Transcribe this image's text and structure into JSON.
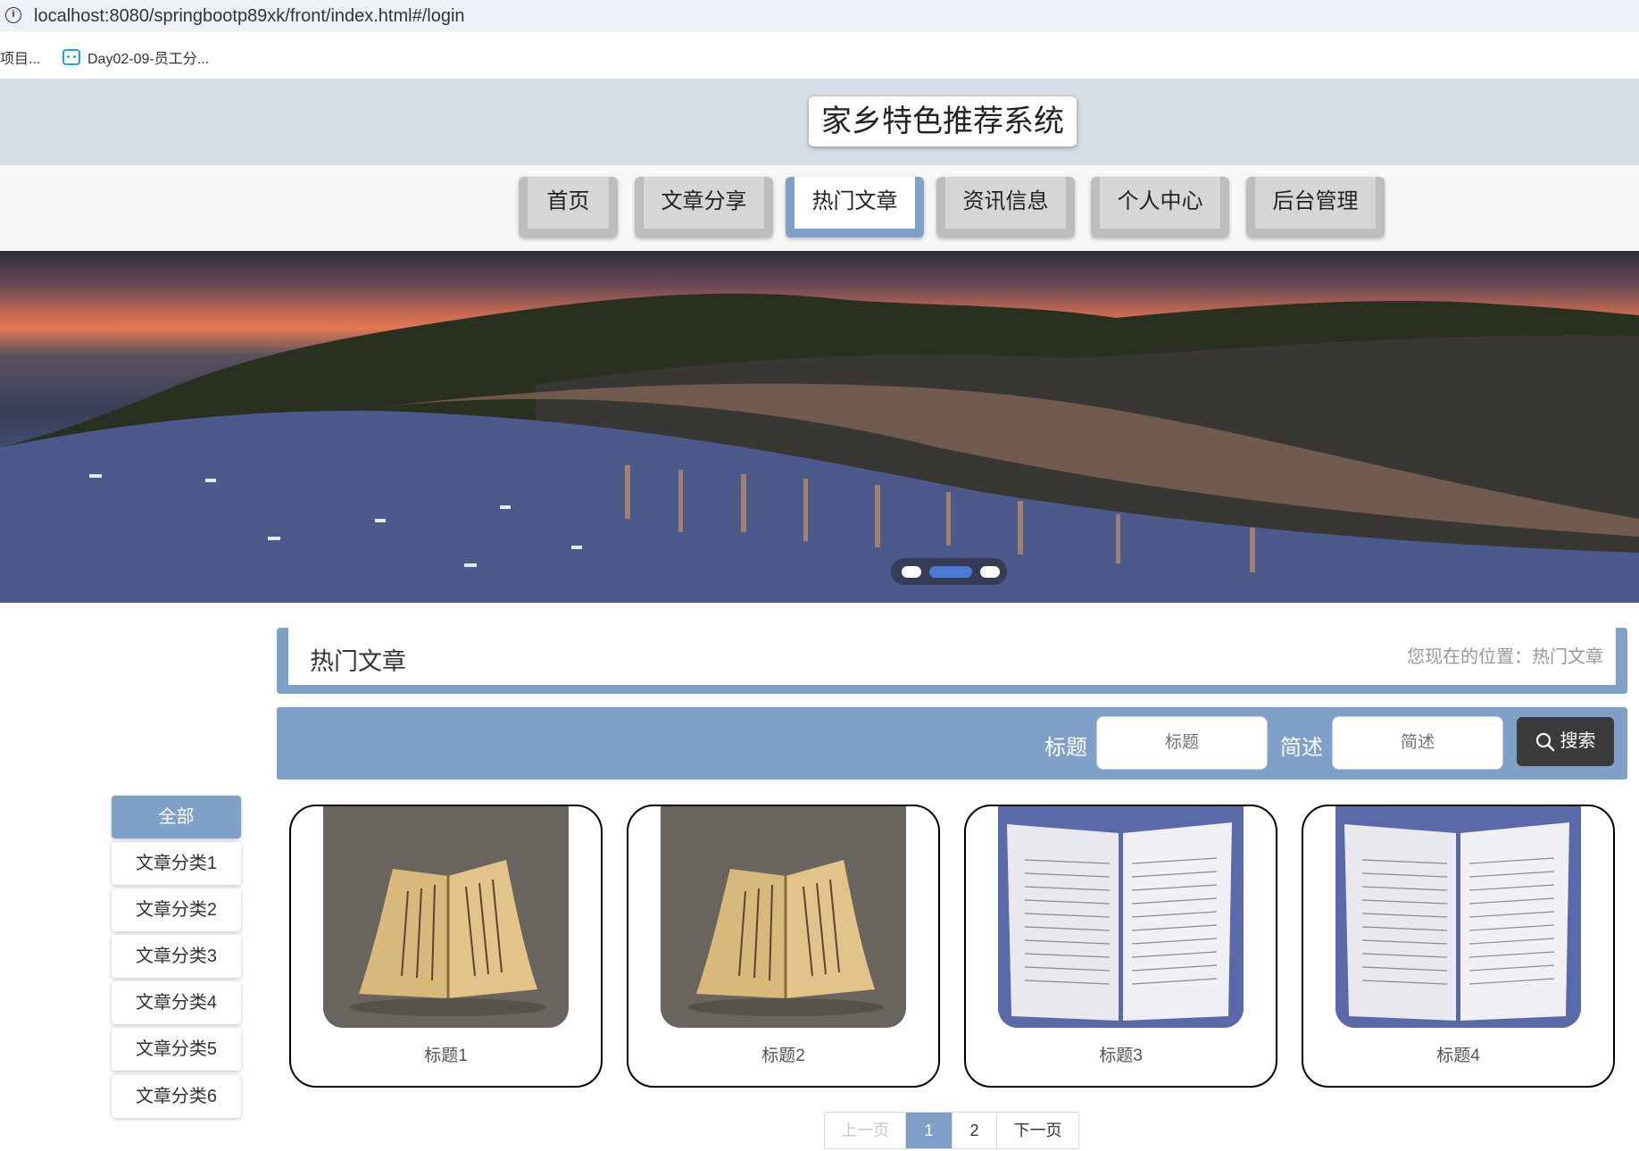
{
  "browser": {
    "url": "localhost:8080/springbootp89xk/front/index.html#/login",
    "bookmarks": [
      "项目...",
      "Day02-09-员工分..."
    ]
  },
  "header": {
    "title": "家乡特色推荐系统"
  },
  "nav": {
    "items": [
      {
        "label": "首页"
      },
      {
        "label": "文章分享"
      },
      {
        "label": "热门文章",
        "active": true
      },
      {
        "label": "资讯信息"
      },
      {
        "label": "个人中心"
      },
      {
        "label": "后台管理"
      }
    ]
  },
  "banner": {
    "slide_count": 3,
    "active_slide": 2
  },
  "section": {
    "title": "热门文章",
    "location": "您现在的位置：热门文章"
  },
  "search": {
    "title_label": "标题",
    "title_placeholder": "标题",
    "desc_label": "简述",
    "desc_placeholder": "简述",
    "button_label": "搜索"
  },
  "categories": [
    {
      "label": "全部",
      "active": true
    },
    {
      "label": "文章分类1"
    },
    {
      "label": "文章分类2"
    },
    {
      "label": "文章分类3"
    },
    {
      "label": "文章分类4"
    },
    {
      "label": "文章分类5"
    },
    {
      "label": "文章分类6"
    }
  ],
  "articles": [
    {
      "title": "标题1"
    },
    {
      "title": "标题2"
    },
    {
      "title": "标题3"
    },
    {
      "title": "标题4"
    }
  ],
  "pagination": {
    "prev_label": "上一页",
    "pages": [
      "1",
      "2"
    ],
    "current": "1",
    "next_label": "下一页"
  },
  "colors": {
    "accent": "#7fa0c8",
    "header_bg": "#d5dde6",
    "search_button": "#3b3b3b"
  }
}
